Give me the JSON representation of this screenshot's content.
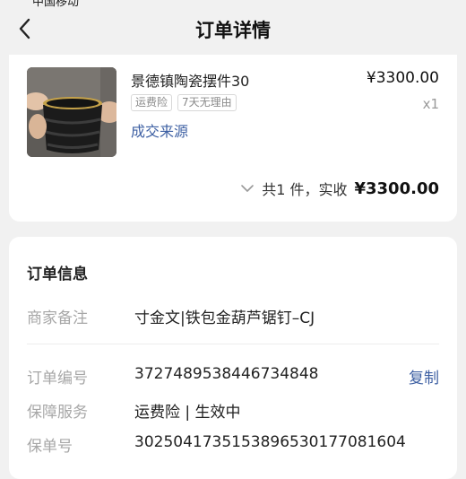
{
  "status": {
    "text": "中国移动"
  },
  "nav": {
    "title": "订单详情"
  },
  "product": {
    "name": "景德镇陶瓷摆件30",
    "price": "¥3300.00",
    "tags": [
      "运费险",
      "7天无理由"
    ],
    "qty": "x1",
    "source_link": "成交来源"
  },
  "summary": {
    "count_label": "共1 件，实收",
    "amount": "¥3300.00"
  },
  "info": {
    "title": "订单信息",
    "remark_label": "商家备注",
    "remark_value": "寸金文|铁包金葫芦锯钉–CJ",
    "order_no_label": "订单编号",
    "order_no_value": "3727489538446734848",
    "copy_label": "复制",
    "service_label": "保障服务",
    "service_value": "运费险 | 生效中",
    "policy_label": "保单号",
    "policy_value": "3025041735153896530177081604"
  },
  "colors": {
    "link": "#3e60a3",
    "label_gray": "#a7a7a7",
    "background": "#f1f1f1"
  },
  "icons": {
    "back": "chevron-left-icon",
    "expand": "chevron-down-icon"
  }
}
